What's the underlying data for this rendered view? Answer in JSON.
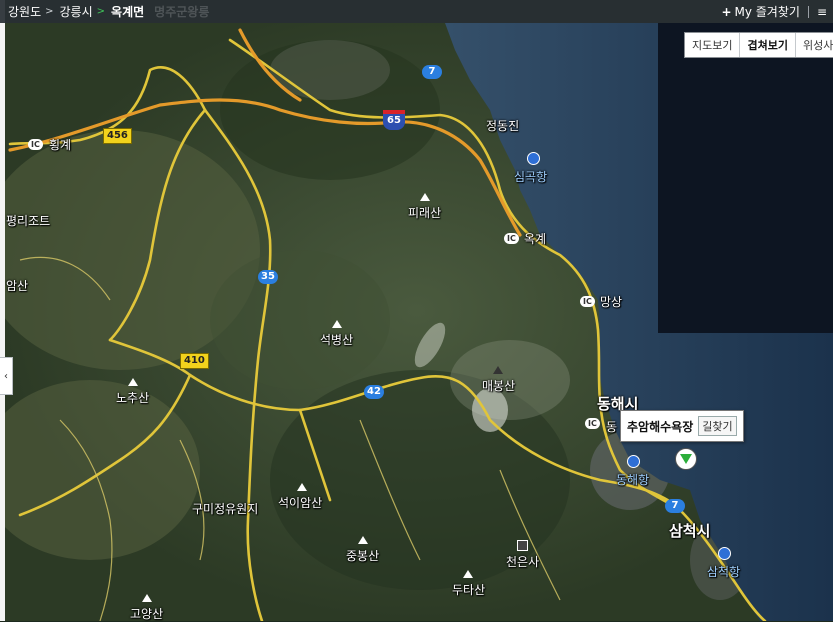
{
  "breadcrumb": {
    "items": [
      {
        "label": "강원도",
        "sep": ">"
      },
      {
        "label": "강릉시",
        "sep": ">"
      },
      {
        "label": "옥계면",
        "sep": ""
      }
    ],
    "faded_text": "명주군왕릉"
  },
  "top_right": {
    "favorites_label": "My 즐겨찾기",
    "favorites_plus": "+",
    "extra": "≡"
  },
  "map_types": [
    {
      "label": "지도보기",
      "active": false
    },
    {
      "label": "겹쳐보기",
      "active": true
    },
    {
      "label": "위성사진",
      "active": false
    }
  ],
  "collapse_icon": "‹",
  "popup": {
    "place_name": "추암해수욕장",
    "directions_label": "길찾기"
  },
  "map_labels": {
    "cities": [
      {
        "id": "donghae",
        "label": "동해시"
      },
      {
        "id": "samcheok",
        "label": "삼척시"
      }
    ],
    "places": [
      {
        "id": "jeongdongjin",
        "label": "정동진"
      },
      {
        "id": "pyeongri",
        "label": "평리조트"
      },
      {
        "id": "gubeong",
        "label": "구미정유원지"
      },
      {
        "id": "cheoneunsa",
        "label": "천은사"
      },
      {
        "id": "angsan",
        "label": "암산"
      },
      {
        "id": "dong_cut",
        "label": "동"
      }
    ],
    "harbors": [
      {
        "id": "simgok",
        "label": "심곡항"
      },
      {
        "id": "donghae_port",
        "label": "동해항"
      },
      {
        "id": "samcheok_port",
        "label": "삼척항"
      }
    ],
    "peaks": [
      {
        "id": "piraesan",
        "label": "피래산"
      },
      {
        "id": "seokbyeongsan",
        "label": "석병산"
      },
      {
        "id": "maebongsan",
        "label": "매봉산"
      },
      {
        "id": "nochusan",
        "label": "노추산"
      },
      {
        "id": "seogamsan",
        "label": "석이암산"
      },
      {
        "id": "jungbongsan",
        "label": "중봉산"
      },
      {
        "id": "dutasan",
        "label": "두타산"
      },
      {
        "id": "goyangsan",
        "label": "고양산"
      }
    ],
    "interchanges": [
      {
        "id": "hoenggye",
        "ic": "IC",
        "label": "횡계"
      },
      {
        "id": "okgye",
        "ic": "IC",
        "label": "옥계"
      },
      {
        "id": "mangsang",
        "ic": "IC",
        "label": "망상"
      },
      {
        "id": "donghae_ic",
        "ic": "IC",
        "label": ""
      }
    ],
    "routes": [
      {
        "id": "r456",
        "label": "456",
        "kind": "nat"
      },
      {
        "id": "r410",
        "label": "410",
        "kind": "nat"
      },
      {
        "id": "r35",
        "label": "35",
        "kind": "blue"
      },
      {
        "id": "r42",
        "label": "42",
        "kind": "blue"
      },
      {
        "id": "r7a",
        "label": "7",
        "kind": "blue"
      },
      {
        "id": "r7b",
        "label": "7",
        "kind": "blue"
      },
      {
        "id": "r65",
        "label": "65",
        "kind": "express"
      }
    ]
  },
  "colors": {
    "sea": "#1f3b55",
    "land": "#33452d",
    "road_major": "#e0c53a",
    "road_express": "#e49a2a",
    "harbor": "#2e6fd6"
  }
}
